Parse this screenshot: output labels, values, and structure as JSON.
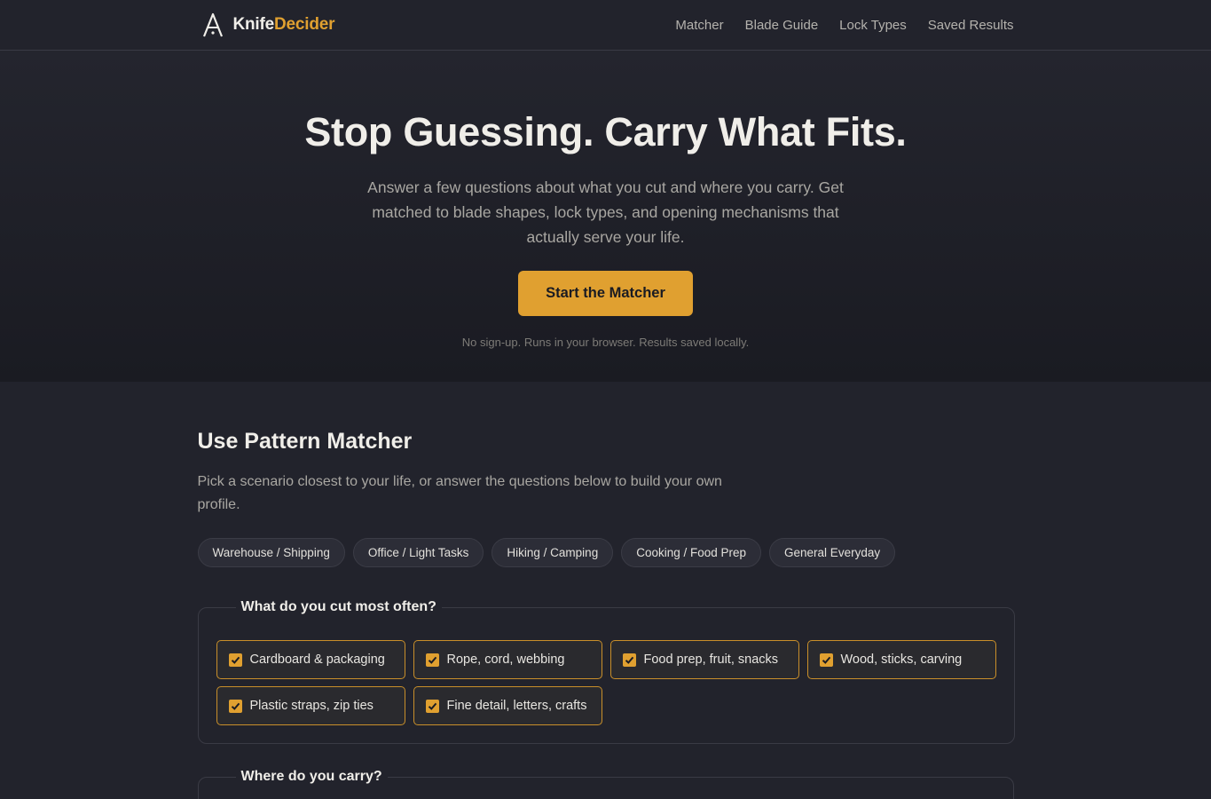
{
  "brand": {
    "name_part1": "Knife",
    "name_part2": "Decider",
    "logo_icon": "a-frame-logo-icon",
    "accent": "#e0a030"
  },
  "nav": [
    {
      "label": "Matcher"
    },
    {
      "label": "Blade Guide"
    },
    {
      "label": "Lock Types"
    },
    {
      "label": "Saved Results"
    }
  ],
  "hero": {
    "title": "Stop Guessing. Carry What Fits.",
    "lead": "Answer a few questions about what you cut and where you carry. Get matched to blade shapes, lock types, and opening mechanisms that actually serve your life.",
    "cta_label": "Start the Matcher",
    "note": "No sign-up. Runs in your browser. Results saved locally."
  },
  "matcher": {
    "title": "Use Pattern Matcher",
    "subtitle": "Pick a scenario closest to your life, or answer the questions below to build your own profile.",
    "scenarios": [
      {
        "label": "Warehouse / Shipping"
      },
      {
        "label": "Office / Light Tasks"
      },
      {
        "label": "Hiking / Camping"
      },
      {
        "label": "Cooking / Food Prep"
      },
      {
        "label": "General Everyday"
      }
    ],
    "cut_question": {
      "legend": "What do you cut most often?",
      "options": [
        {
          "label": "Cardboard & packaging",
          "checked": true
        },
        {
          "label": "Rope, cord, webbing",
          "checked": true
        },
        {
          "label": "Food prep, fruit, snacks",
          "checked": true
        },
        {
          "label": "Wood, sticks, carving",
          "checked": true
        },
        {
          "label": "Plastic straps, zip ties",
          "checked": true
        },
        {
          "label": "Fine detail, letters, crafts",
          "checked": true
        }
      ]
    },
    "carry_question": {
      "legend": "Where do you carry?"
    }
  }
}
